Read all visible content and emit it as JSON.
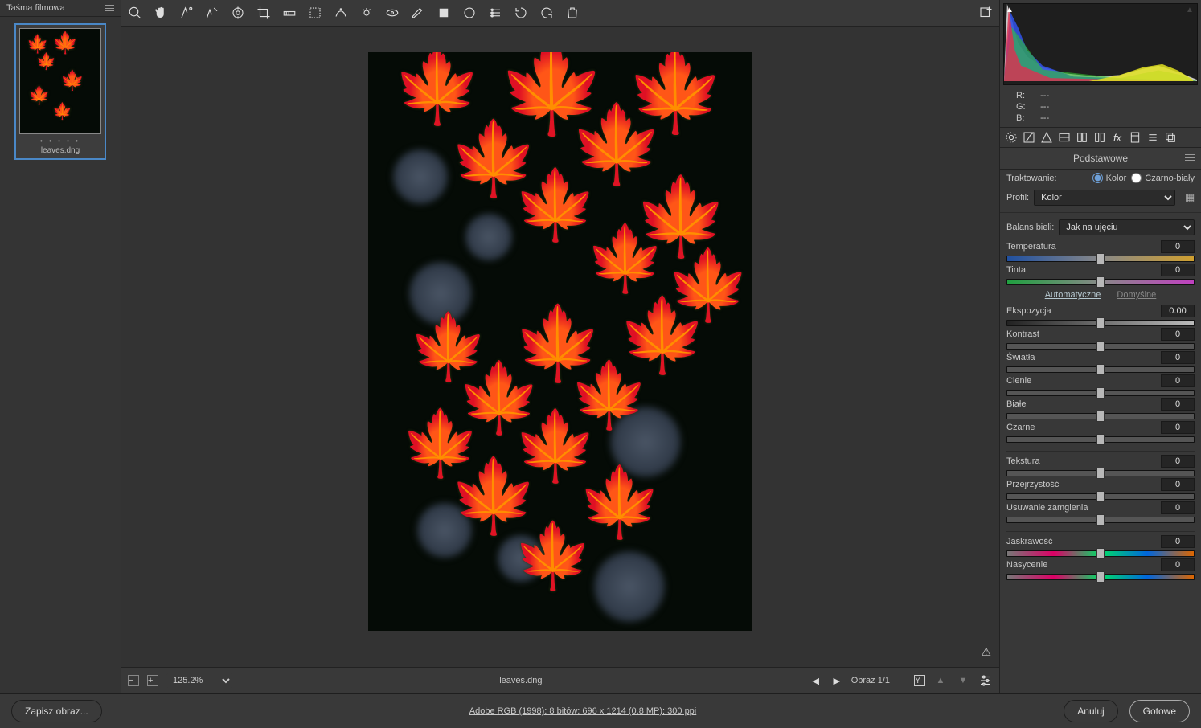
{
  "filmstrip": {
    "title": "Taśma filmowa",
    "thumb_name": "leaves.dng"
  },
  "zoom": "125.2%",
  "filename": "leaves.dng",
  "image_nav": "Obraz 1/1",
  "metadata": "Adobe RGB (1998); 8 bitów; 696 x 1214 (0.8 MP); 300 ppi",
  "rgb": {
    "r": "R:",
    "g": "G:",
    "b": "B:",
    "val": "---"
  },
  "panel": {
    "title": "Podstawowe",
    "treatment_label": "Traktowanie:",
    "treat_color": "Kolor",
    "treat_bw": "Czarno-biały",
    "profile_label": "Profil:",
    "profile_value": "Kolor",
    "wb_label": "Balans bieli:",
    "wb_value": "Jak na ujęciu",
    "auto": "Automatyczne",
    "default": "Domyślne",
    "sliders": {
      "temperatura": {
        "label": "Temperatura",
        "val": "0"
      },
      "tinta": {
        "label": "Tinta",
        "val": "0"
      },
      "ekspozycja": {
        "label": "Ekspozycja",
        "val": "0.00"
      },
      "kontrast": {
        "label": "Kontrast",
        "val": "0"
      },
      "swiatla": {
        "label": "Światła",
        "val": "0"
      },
      "cienie": {
        "label": "Cienie",
        "val": "0"
      },
      "biale": {
        "label": "Białe",
        "val": "0"
      },
      "czarne": {
        "label": "Czarne",
        "val": "0"
      },
      "tekstura": {
        "label": "Tekstura",
        "val": "0"
      },
      "przejrzystosc": {
        "label": "Przejrzystość",
        "val": "0"
      },
      "dehaze": {
        "label": "Usuwanie zamglenia",
        "val": "0"
      },
      "jaskrawosc": {
        "label": "Jaskrawość",
        "val": "0"
      },
      "nasycenie": {
        "label": "Nasycenie",
        "val": "0"
      }
    }
  },
  "footer": {
    "save": "Zapisz obraz...",
    "cancel": "Anuluj",
    "done": "Gotowe"
  }
}
